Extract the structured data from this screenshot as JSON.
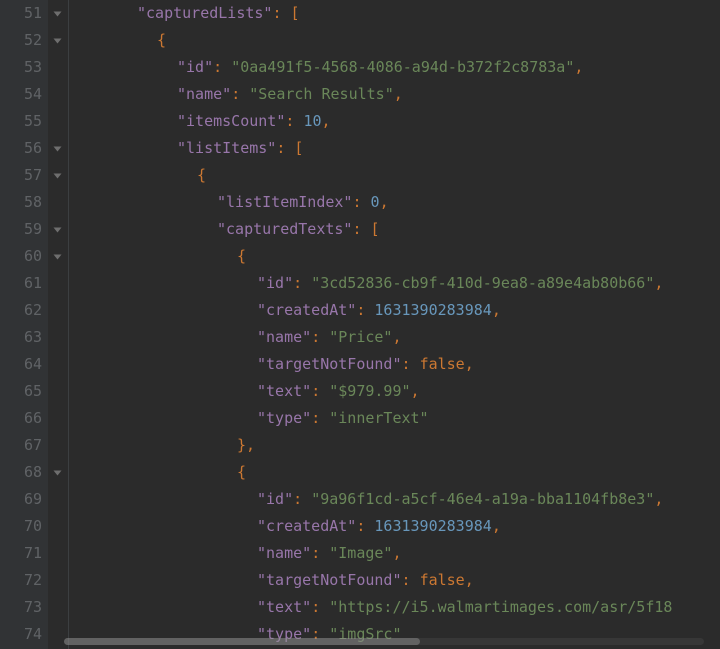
{
  "firstLineNumber": 51,
  "lines": [
    {
      "indent": 3,
      "fold": true,
      "tokens": [
        {
          "t": "key",
          "v": "\"capturedLists\""
        },
        {
          "t": "punc",
          "v": ": ["
        }
      ]
    },
    {
      "indent": 4,
      "fold": true,
      "tokens": [
        {
          "t": "punc",
          "v": "{"
        }
      ]
    },
    {
      "indent": 5,
      "fold": false,
      "tokens": [
        {
          "t": "key",
          "v": "\"id\""
        },
        {
          "t": "punc",
          "v": ": "
        },
        {
          "t": "str",
          "v": "\"0aa491f5-4568-4086-a94d-b372f2c8783a\""
        },
        {
          "t": "punc",
          "v": ","
        }
      ]
    },
    {
      "indent": 5,
      "fold": false,
      "tokens": [
        {
          "t": "key",
          "v": "\"name\""
        },
        {
          "t": "punc",
          "v": ": "
        },
        {
          "t": "str",
          "v": "\"Search Results\""
        },
        {
          "t": "punc",
          "v": ","
        }
      ]
    },
    {
      "indent": 5,
      "fold": false,
      "tokens": [
        {
          "t": "key",
          "v": "\"itemsCount\""
        },
        {
          "t": "punc",
          "v": ": "
        },
        {
          "t": "num",
          "v": "10"
        },
        {
          "t": "punc",
          "v": ","
        }
      ]
    },
    {
      "indent": 5,
      "fold": true,
      "tokens": [
        {
          "t": "key",
          "v": "\"listItems\""
        },
        {
          "t": "punc",
          "v": ": ["
        }
      ]
    },
    {
      "indent": 6,
      "fold": true,
      "tokens": [
        {
          "t": "punc",
          "v": "{"
        }
      ]
    },
    {
      "indent": 7,
      "fold": false,
      "tokens": [
        {
          "t": "key",
          "v": "\"listItemIndex\""
        },
        {
          "t": "punc",
          "v": ": "
        },
        {
          "t": "num",
          "v": "0"
        },
        {
          "t": "punc",
          "v": ","
        }
      ]
    },
    {
      "indent": 7,
      "fold": true,
      "tokens": [
        {
          "t": "key",
          "v": "\"capturedTexts\""
        },
        {
          "t": "punc",
          "v": ": ["
        }
      ]
    },
    {
      "indent": 8,
      "fold": true,
      "tokens": [
        {
          "t": "punc",
          "v": "{"
        }
      ]
    },
    {
      "indent": 9,
      "fold": false,
      "tokens": [
        {
          "t": "key",
          "v": "\"id\""
        },
        {
          "t": "punc",
          "v": ": "
        },
        {
          "t": "str",
          "v": "\"3cd52836-cb9f-410d-9ea8-a89e4ab80b66\""
        },
        {
          "t": "punc",
          "v": ","
        }
      ]
    },
    {
      "indent": 9,
      "fold": false,
      "tokens": [
        {
          "t": "key",
          "v": "\"createdAt\""
        },
        {
          "t": "punc",
          "v": ": "
        },
        {
          "t": "num",
          "v": "1631390283984"
        },
        {
          "t": "punc",
          "v": ","
        }
      ]
    },
    {
      "indent": 9,
      "fold": false,
      "tokens": [
        {
          "t": "key",
          "v": "\"name\""
        },
        {
          "t": "punc",
          "v": ": "
        },
        {
          "t": "str",
          "v": "\"Price\""
        },
        {
          "t": "punc",
          "v": ","
        }
      ]
    },
    {
      "indent": 9,
      "fold": false,
      "tokens": [
        {
          "t": "key",
          "v": "\"targetNotFound\""
        },
        {
          "t": "punc",
          "v": ": "
        },
        {
          "t": "kw",
          "v": "false"
        },
        {
          "t": "punc",
          "v": ","
        }
      ]
    },
    {
      "indent": 9,
      "fold": false,
      "tokens": [
        {
          "t": "key",
          "v": "\"text\""
        },
        {
          "t": "punc",
          "v": ": "
        },
        {
          "t": "str",
          "v": "\"$979.99\""
        },
        {
          "t": "punc",
          "v": ","
        }
      ]
    },
    {
      "indent": 9,
      "fold": false,
      "tokens": [
        {
          "t": "key",
          "v": "\"type\""
        },
        {
          "t": "punc",
          "v": ": "
        },
        {
          "t": "str",
          "v": "\"innerText\""
        }
      ]
    },
    {
      "indent": 8,
      "fold": false,
      "tokens": [
        {
          "t": "punc",
          "v": "},"
        }
      ]
    },
    {
      "indent": 8,
      "fold": true,
      "tokens": [
        {
          "t": "punc",
          "v": "{"
        }
      ]
    },
    {
      "indent": 9,
      "fold": false,
      "tokens": [
        {
          "t": "key",
          "v": "\"id\""
        },
        {
          "t": "punc",
          "v": ": "
        },
        {
          "t": "str",
          "v": "\"9a96f1cd-a5cf-46e4-a19a-bba1104fb8e3\""
        },
        {
          "t": "punc",
          "v": ","
        }
      ]
    },
    {
      "indent": 9,
      "fold": false,
      "tokens": [
        {
          "t": "key",
          "v": "\"createdAt\""
        },
        {
          "t": "punc",
          "v": ": "
        },
        {
          "t": "num",
          "v": "1631390283984"
        },
        {
          "t": "punc",
          "v": ","
        }
      ]
    },
    {
      "indent": 9,
      "fold": false,
      "tokens": [
        {
          "t": "key",
          "v": "\"name\""
        },
        {
          "t": "punc",
          "v": ": "
        },
        {
          "t": "str",
          "v": "\"Image\""
        },
        {
          "t": "punc",
          "v": ","
        }
      ]
    },
    {
      "indent": 9,
      "fold": false,
      "tokens": [
        {
          "t": "key",
          "v": "\"targetNotFound\""
        },
        {
          "t": "punc",
          "v": ": "
        },
        {
          "t": "kw",
          "v": "false"
        },
        {
          "t": "punc",
          "v": ","
        }
      ]
    },
    {
      "indent": 9,
      "fold": false,
      "tokens": [
        {
          "t": "key",
          "v": "\"text\""
        },
        {
          "t": "punc",
          "v": ": "
        },
        {
          "t": "str",
          "v": "\"https://i5.walmartimages.com/asr/5f18"
        }
      ]
    },
    {
      "indent": 9,
      "fold": false,
      "tokens": [
        {
          "t": "key",
          "v": "\"type\""
        },
        {
          "t": "punc",
          "v": ": "
        },
        {
          "t": "str",
          "v": "\"imgSrc\""
        }
      ]
    }
  ]
}
